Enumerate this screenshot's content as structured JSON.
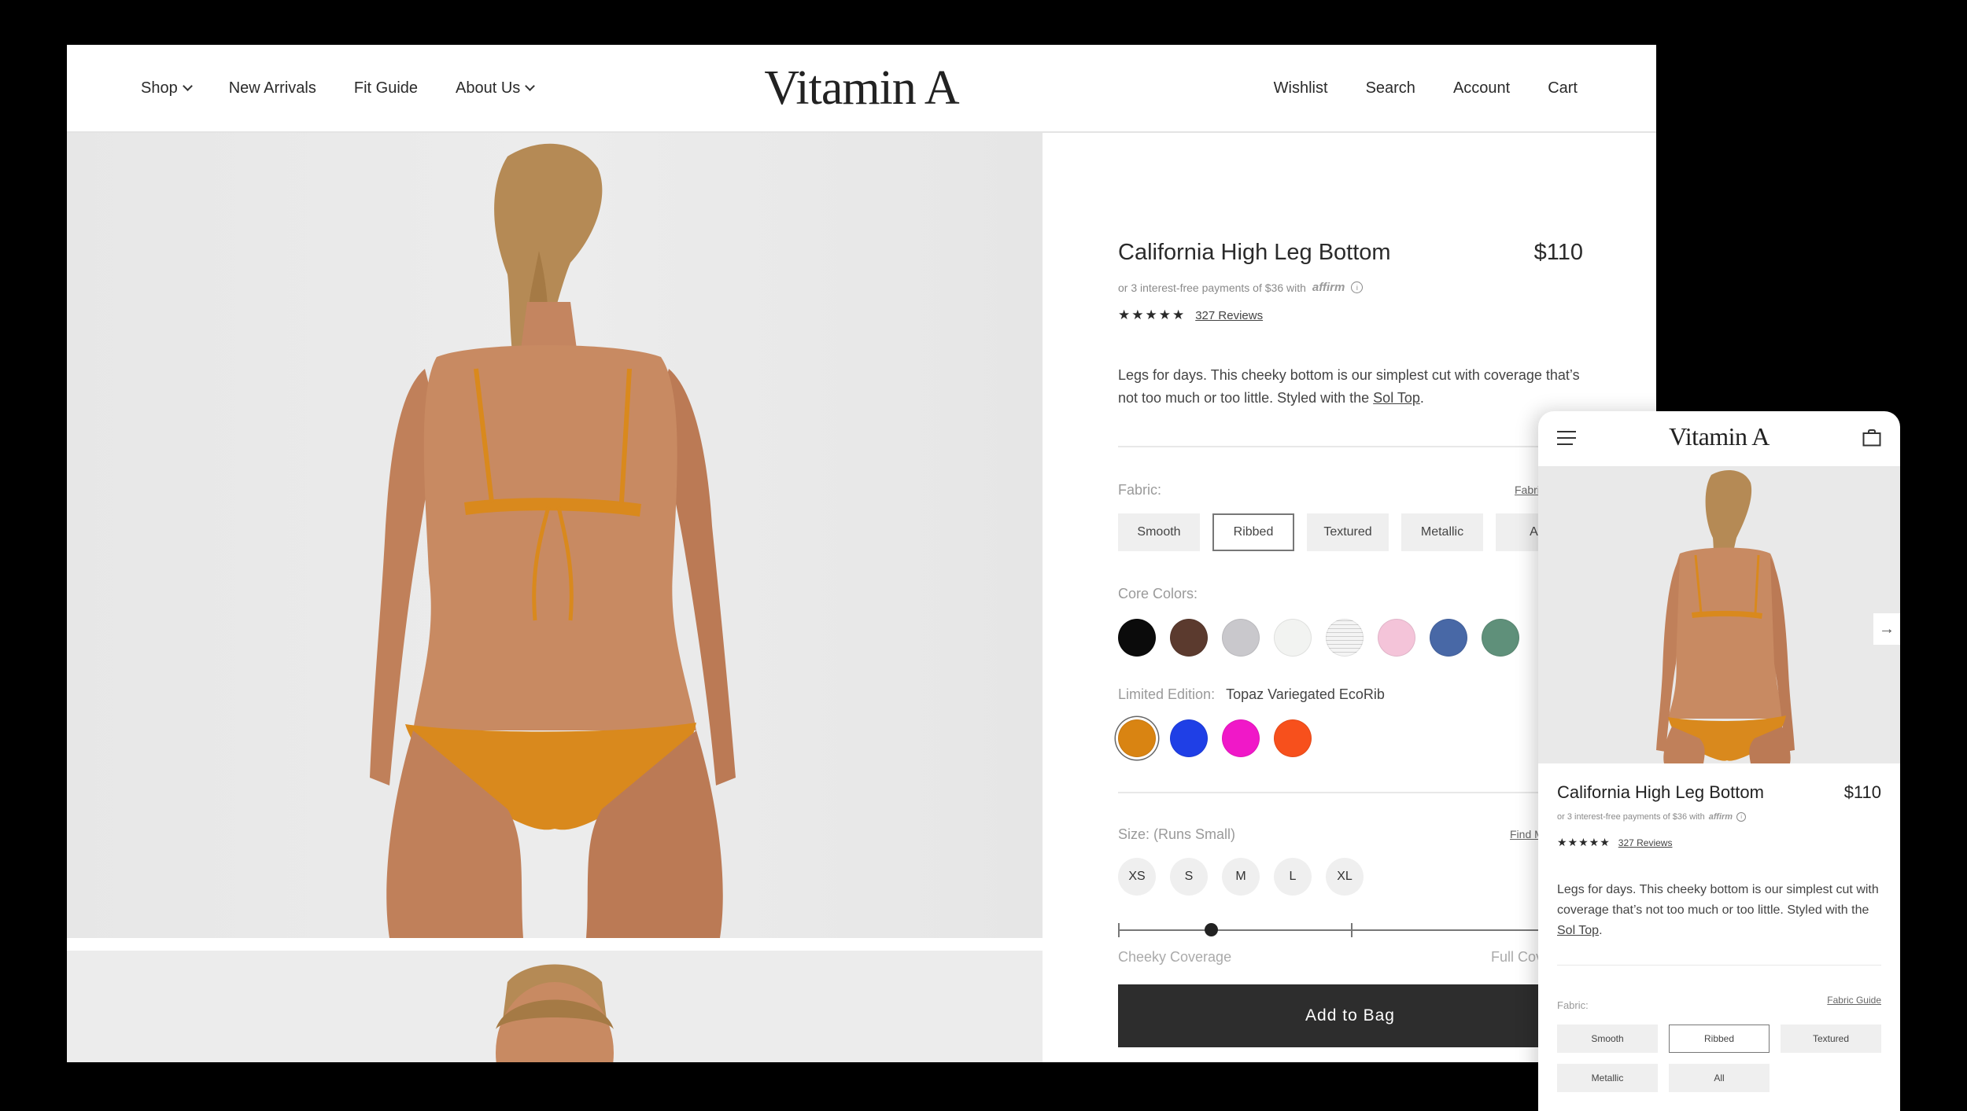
{
  "brand": {
    "name": "Vitamin A"
  },
  "nav": {
    "left": [
      {
        "label": "Shop",
        "dropdown": true
      },
      {
        "label": "New Arrivals",
        "dropdown": false
      },
      {
        "label": "Fit Guide",
        "dropdown": false
      },
      {
        "label": "About Us",
        "dropdown": true
      }
    ],
    "right": [
      "Wishlist",
      "Search",
      "Account",
      "Cart"
    ]
  },
  "product": {
    "title": "California High Leg Bottom",
    "price": "$110",
    "affirm_text": "or 3 interest-free payments of $36 with",
    "affirm_brand": "affirm",
    "stars": "★★★★★",
    "reviews": "327 Reviews",
    "description_pre": "Legs for days. This cheeky bottom is our simplest cut with coverage that’s not too much or too little. Styled with the ",
    "description_link": "Sol Top",
    "description_post": "."
  },
  "fabric": {
    "label": "Fabric:",
    "guide_label": "Fabric Guide",
    "options": [
      "Smooth",
      "Ribbed",
      "Textured",
      "Metallic",
      "All"
    ],
    "selected": "Ribbed"
  },
  "core_colors": {
    "label": "Core Colors:",
    "swatches": [
      "#0b0b0b",
      "#5b3a2e",
      "#c9c8cc",
      "#f2f3f1",
      "#e7e7e7",
      "#f4c4d9",
      "#4868a6",
      "#5f907a"
    ]
  },
  "limited_edition": {
    "label": "Limited Edition:",
    "value": "Topaz Variegated EcoRib",
    "swatches": [
      "#d98412",
      "#1f3fe6",
      "#f018c8",
      "#f7501c"
    ],
    "selected_index": 0
  },
  "size": {
    "label": "Size: (Runs Small)",
    "guide_label": "Find My Size",
    "options": [
      "XS",
      "S",
      "M",
      "L",
      "XL"
    ]
  },
  "coverage": {
    "left_label": "Cheeky Coverage",
    "right_label": "Full Coverage",
    "value": 0.2
  },
  "add_to_bag": "Add to Bag",
  "mobile": {
    "arrow": "→"
  },
  "colors": {
    "product_orange": "#d9891d",
    "button_dark": "#2d2d2d"
  }
}
